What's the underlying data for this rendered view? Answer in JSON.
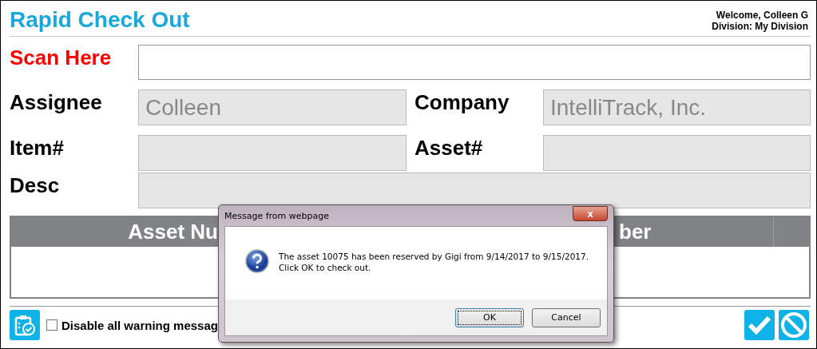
{
  "header": {
    "title": "Rapid Check Out",
    "welcome": "Welcome, Colleen G",
    "division": "Division: My Division"
  },
  "scan": {
    "label": "Scan Here"
  },
  "field_rows": [
    [
      {
        "label": "Assignee",
        "value": "Colleen"
      },
      {
        "label": "Company",
        "value": "IntelliTrack, Inc."
      }
    ],
    [
      {
        "label": "Item#"
      },
      {
        "label": "Asset#"
      }
    ],
    [
      {
        "label": "Desc"
      }
    ]
  ],
  "table": {
    "header_left": "Asset Nu",
    "header_right": "ber"
  },
  "footer": {
    "checkbox_label": "Disable all warning messag",
    "checked": false
  },
  "dialog": {
    "title": "Message from webpage",
    "close": "x",
    "message_1": "The asset 10075 has been reserved by Gigi from 9/14/2017 to 9/15/2017.",
    "message_2": "Click OK to check out.",
    "buttons": [
      {
        "label": "OK",
        "selected": true
      },
      {
        "label": "Cancel",
        "selected": false
      }
    ]
  }
}
